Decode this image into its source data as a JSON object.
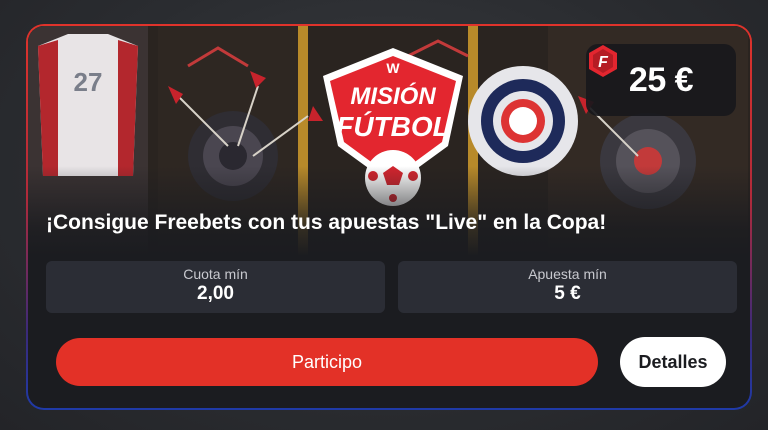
{
  "promo": {
    "logo_text_line1": "MISIÓN",
    "logo_text_line2": "FÚTBOL",
    "logo_top_mark": "W",
    "jersey_number": "27",
    "amount": "25 €",
    "coin_letter": "F",
    "headline": "¡Consigue Freebets con tus apuestas \"Live\" en la Copa!",
    "stats": [
      {
        "label": "Cuota mín",
        "value": "2,00"
      },
      {
        "label": "Apuesta mín",
        "value": "5 €"
      }
    ],
    "primary_button_label": "Participo",
    "secondary_button_label": "Detalles"
  },
  "colors": {
    "accent_red": "#e33127",
    "border_top": "#e0332b",
    "border_bottom": "#1f3aa8",
    "card_bg": "#1b1c20",
    "stat_bg": "#2b2d35"
  },
  "icons": {
    "coin": "freebet-coin-icon",
    "logo": "mision-futbol-logo",
    "ball": "soccer-ball-icon"
  }
}
